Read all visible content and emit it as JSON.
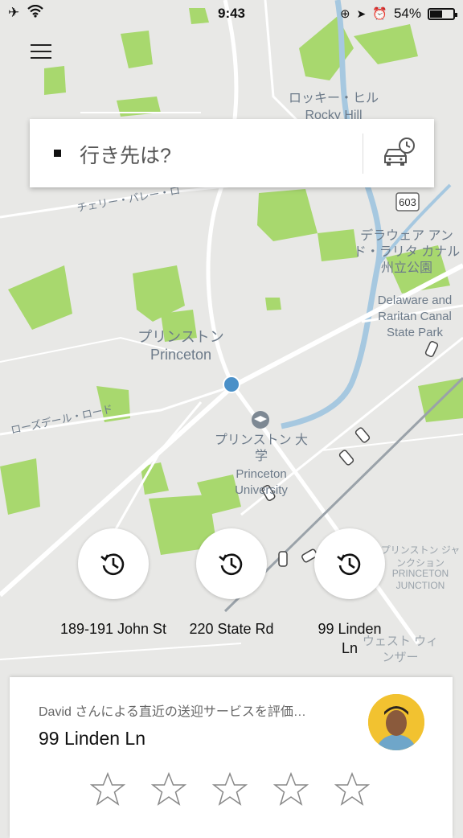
{
  "status_bar": {
    "time": "9:43",
    "battery": "54%",
    "battery_level": 0.54
  },
  "search": {
    "placeholder": "行き先は?"
  },
  "map_labels": {
    "rocky_hill_jp": "ロッキー・ヒル",
    "rocky_hill_en": "Rocky Hill",
    "road_603": "603",
    "cherry_valley": "チェリー・バレー・ロ",
    "canal_jp": "デラウェア アンド・ラリタ カナル 州立公園",
    "canal_en": "Delaware and Raritan Canal State Park",
    "princeton_jp": "プリンストン",
    "princeton_en": "Princeton",
    "rosedale": "ローズデール・ロード",
    "university_jp": "プリンストン 大学",
    "university_en": "Princeton University",
    "junction_jp": "プリンストン ジャンクション",
    "junction_en": "PRINCETON JUNCTION",
    "west_windsor": "ウェスト ウィンザー"
  },
  "shortcuts": [
    {
      "label": "189-191 John St",
      "icon": "history-icon"
    },
    {
      "label": "220 State Rd",
      "icon": "history-icon"
    },
    {
      "label": "99 Linden Ln",
      "icon": "history-icon"
    }
  ],
  "rating_card": {
    "prompt": "David さんによる直近の送迎サービスを評価…",
    "address": "99 Linden Ln",
    "stars": 5
  }
}
